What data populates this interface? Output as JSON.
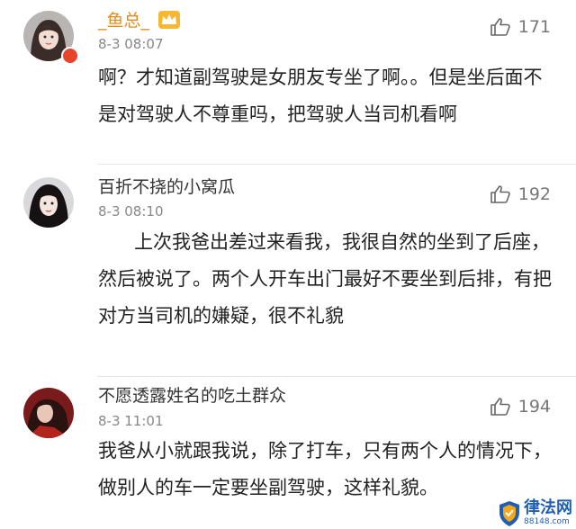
{
  "colors": {
    "accent_name": "#e88a1a",
    "divider": "#e6e6e6",
    "time": "#888888",
    "watermark": "#1e5fb4"
  },
  "comments": [
    {
      "user": "_鱼总_",
      "time": "8-3 08:07",
      "likes": "171",
      "text": "啊？才知道副驾驶是女朋友专坐了啊。。但是坐后面不是对驾驶人不尊重吗，把驾驶人当司机看啊",
      "avatar_icon": "female-avatar-icon",
      "badge_icon": "vip-badge-icon",
      "crown_icon": "crown-icon"
    },
    {
      "user": "百折不挠的小窝瓜",
      "time": "8-3 08:10",
      "likes": "192",
      "text": "      上次我爸出差过来看我，我很自然的坐到了后座，然后被说了。两个人开车出门最好不要坐到后排，有把对方当司机的嫌疑，很不礼貌",
      "avatar_icon": "female-avatar-icon"
    },
    {
      "user": "不愿透露姓名的吃土群众",
      "time": "8-3 11:01",
      "likes": "194",
      "text": "我爸从小就跟我说，除了打车，只有两个人的情况下，做别人的车一定要坐副驾驶，这样礼貌。",
      "avatar_icon": "female-avatar-icon"
    }
  ],
  "watermark": {
    "brand": "律法网",
    "url": "88148.com",
    "icon": "shield-logo-icon"
  }
}
